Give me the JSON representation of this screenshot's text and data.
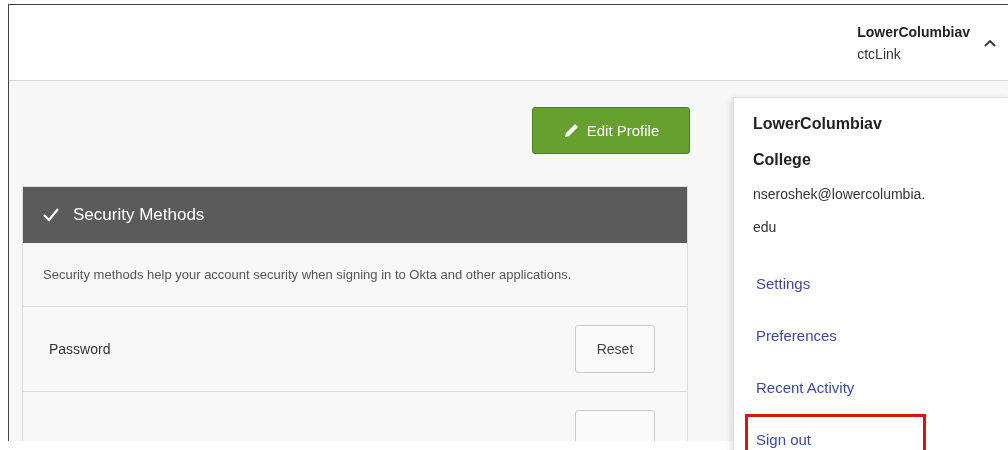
{
  "header": {
    "user_name": "LowerColumbiav",
    "org": "ctcLink",
    "menu_expanded": true
  },
  "edit_button": "Edit Profile",
  "security": {
    "title": "Security Methods",
    "description": "Security methods help your account security when signing in to Okta and other applications.",
    "rows": [
      {
        "label": "Password",
        "button": "Reset"
      }
    ]
  },
  "user_menu": {
    "org_name": "LowerColumbiav College",
    "email": "nseroshek@lowercolumbia.edu",
    "items": [
      {
        "label": "Settings",
        "highlighted": false
      },
      {
        "label": "Preferences",
        "highlighted": false
      },
      {
        "label": "Recent Activity",
        "highlighted": false
      },
      {
        "label": "Sign out",
        "highlighted": true
      }
    ]
  }
}
